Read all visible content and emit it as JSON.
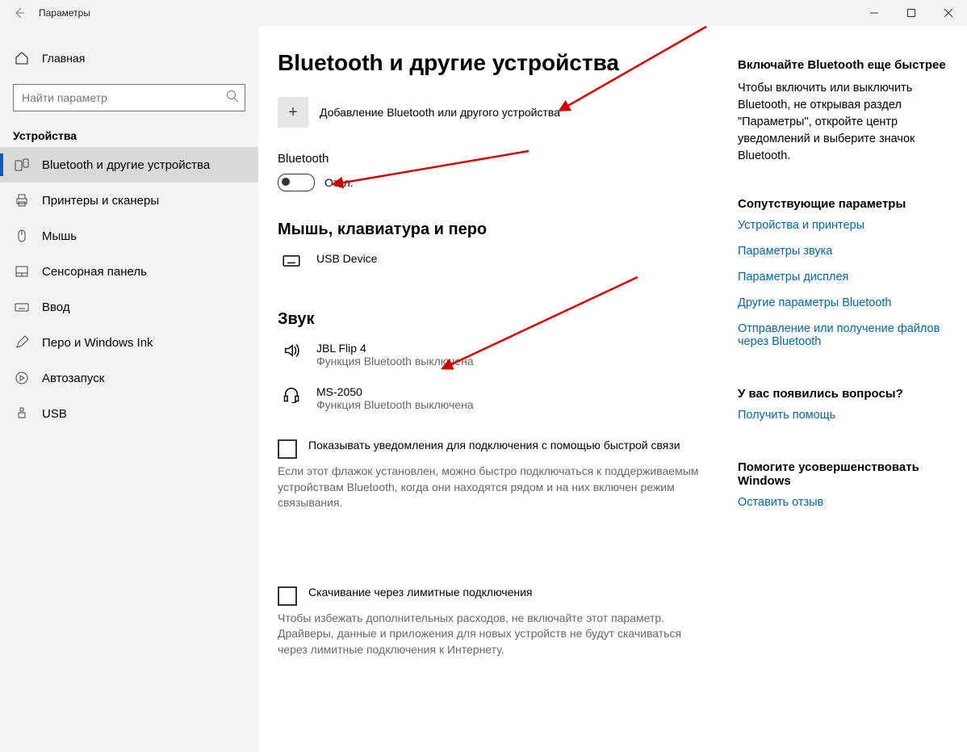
{
  "titlebar": {
    "title": "Параметры"
  },
  "sidebar": {
    "home": "Главная",
    "search_placeholder": "Найти параметр",
    "group": "Устройства",
    "items": [
      {
        "label": "Bluetooth и другие устройства",
        "active": true,
        "icon": "devices"
      },
      {
        "label": "Принтеры и сканеры",
        "icon": "printer"
      },
      {
        "label": "Мышь",
        "icon": "mouse"
      },
      {
        "label": "Сенсорная панель",
        "icon": "touchpad"
      },
      {
        "label": "Ввод",
        "icon": "typing"
      },
      {
        "label": "Перо и Windows Ink",
        "icon": "pen"
      },
      {
        "label": "Автозапуск",
        "icon": "autoplay"
      },
      {
        "label": "USB",
        "icon": "usb"
      }
    ]
  },
  "main": {
    "title": "Bluetooth и другие устройства",
    "add": "Добавление Bluetooth или другого устройства",
    "bt_label": "Bluetooth",
    "bt_state": "Откл.",
    "sections": {
      "input": {
        "title": "Мышь, клавиатура и перо",
        "devices": [
          {
            "name": "USB Device",
            "icon": "keyboard"
          }
        ]
      },
      "audio": {
        "title": "Звук",
        "devices": [
          {
            "name": "JBL Flip 4",
            "sub": "Функция Bluetooth выключена",
            "icon": "speaker"
          },
          {
            "name": "MS-2050",
            "sub": "Функция Bluetooth выключена",
            "icon": "headset"
          }
        ]
      }
    },
    "check1": {
      "label": "Показывать уведомления для подключения с помощью быстрой связи",
      "desc": "Если этот флажок установлен, можно быстро подключаться к поддерживаемым устройствам Bluetooth, когда они находятся рядом и на них включен режим связывания."
    },
    "check2": {
      "label": "Скачивание через лимитные подключения",
      "desc": "Чтобы избежать дополнительных расходов, не включайте этот параметр. Драйверы, данные и приложения для новых устройств не будут скачиваться через лимитные подключения к Интернету."
    }
  },
  "right": {
    "tip_h": "Включайте Bluetooth еще быстрее",
    "tip_t": "Чтобы включить или выключить Bluetooth, не открывая раздел \"Параметры\", откройте центр уведомлений и выберите значок Bluetooth.",
    "related_h": "Сопутствующие параметры",
    "links": [
      "Устройства и принтеры",
      "Параметры звука",
      "Параметры дисплея",
      "Другие параметры Bluetooth",
      "Отправление или получение файлов через Bluetooth"
    ],
    "q_h": "У вас появились вопросы?",
    "q_link": "Получить помощь",
    "fb_h": "Помогите усовершенствовать Windows",
    "fb_link": "Оставить отзыв"
  }
}
